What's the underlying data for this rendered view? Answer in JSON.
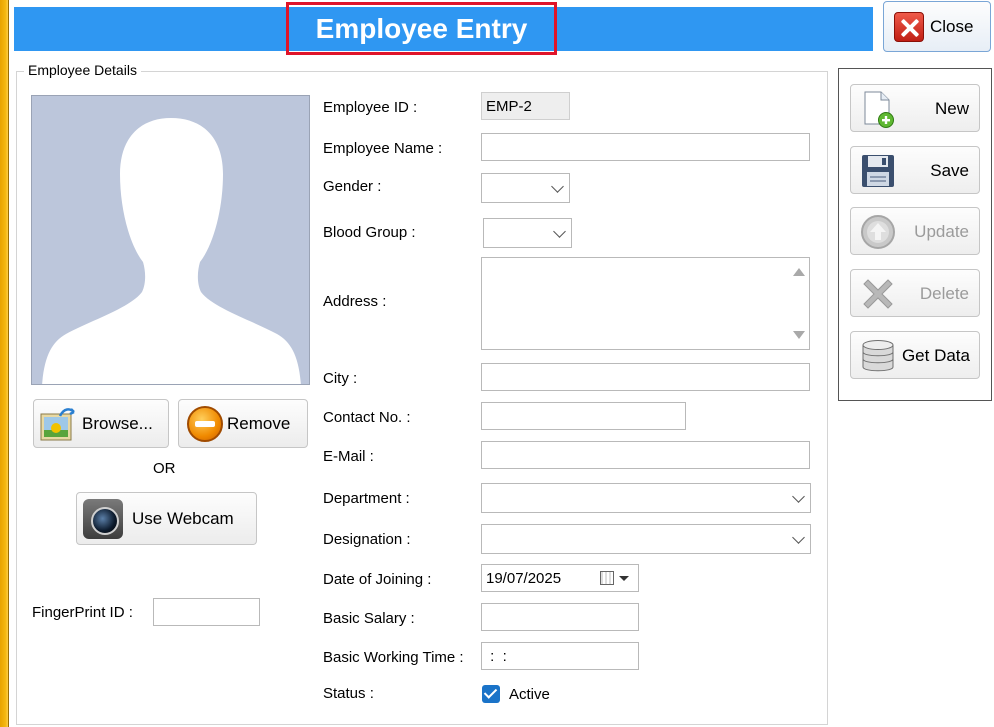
{
  "window": {
    "title": "Employee Entry",
    "close_label": "Close"
  },
  "group": {
    "title": "Employee Details"
  },
  "photo_actions": {
    "browse_label": "Browse...",
    "remove_label": "Remove",
    "or_label": "OR",
    "webcam_label": "Use Webcam"
  },
  "fingerprint": {
    "label": "FingerPrint ID :",
    "value": ""
  },
  "form": {
    "employee_id": {
      "label": "Employee ID :",
      "value": "EMP-2"
    },
    "employee_name": {
      "label": "Employee Name :",
      "value": ""
    },
    "gender": {
      "label": "Gender :",
      "value": ""
    },
    "blood_group": {
      "label": "Blood Group :",
      "value": ""
    },
    "address": {
      "label": "Address :",
      "value": ""
    },
    "city": {
      "label": "City :",
      "value": ""
    },
    "contact_no": {
      "label": "Contact No. :",
      "value": ""
    },
    "email": {
      "label": "E-Mail :",
      "value": ""
    },
    "department": {
      "label": "Department :",
      "value": ""
    },
    "designation": {
      "label": "Designation :",
      "value": ""
    },
    "date_of_joining": {
      "label": "Date of Joining :",
      "value": "19/07/2025"
    },
    "basic_salary": {
      "label": "Basic Salary :",
      "value": ""
    },
    "basic_working_time": {
      "label": "Basic Working Time :",
      "value": " :  :"
    },
    "status": {
      "label": "Status :",
      "checkbox_label": "Active",
      "checked": true
    }
  },
  "actions": {
    "new_label": "New",
    "save_label": "Save",
    "update_label": "Update",
    "delete_label": "Delete",
    "get_data_label": "Get Data"
  },
  "icons": {
    "close": "close-icon",
    "browse": "picture-icon",
    "remove": "minus-circle-icon",
    "webcam": "webcam-icon",
    "new": "new-document-icon",
    "save": "floppy-disk-icon",
    "update": "up-arrow-circle-icon",
    "delete": "x-icon",
    "get_data": "database-icon",
    "date_picker": "calendar-icon"
  },
  "colors": {
    "title_bar": "#2f97f2",
    "title_highlight": "#e0142a",
    "checkbox": "#1a73c8",
    "left_stripe": "#f5b70f"
  }
}
